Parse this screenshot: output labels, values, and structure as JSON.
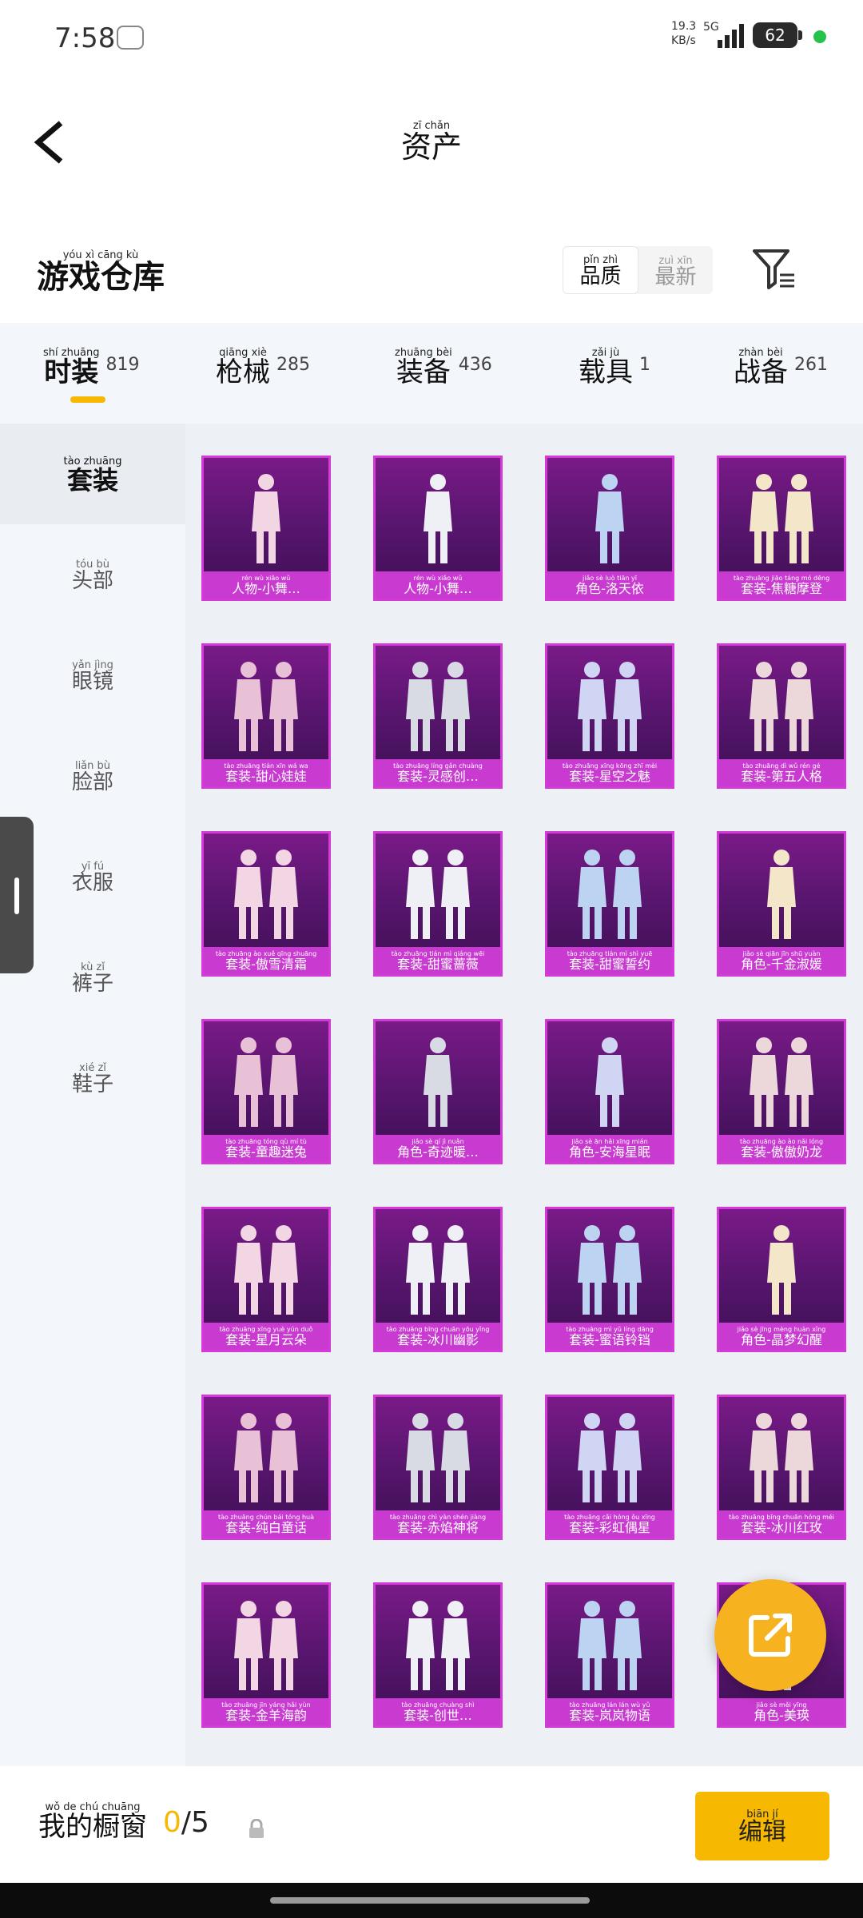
{
  "status_bar": {
    "time": "7:58",
    "net_speed_top": "19.3",
    "net_speed_unit": "KB/s",
    "network_type": "5G",
    "battery": "62"
  },
  "header": {
    "title": {
      "hz": "资产",
      "py": "zī chǎn"
    }
  },
  "warehouse": {
    "title": {
      "hz": "游戏仓库",
      "py": "yóu xì cāng kù"
    }
  },
  "sort_options": [
    {
      "hz": "品质",
      "py": "pǐn zhì",
      "active": true
    },
    {
      "hz": "最新",
      "py": "zuì xīn",
      "active": false
    }
  ],
  "tabs": [
    {
      "hz": "时装",
      "py": "shí zhuāng",
      "count": "819",
      "active": true
    },
    {
      "hz": "枪械",
      "py": "qiāng xiè",
      "count": "285"
    },
    {
      "hz": "装备",
      "py": "zhuāng bèi",
      "count": "436"
    },
    {
      "hz": "载具",
      "py": "zǎi jù",
      "count": "1"
    },
    {
      "hz": "战备",
      "py": "zhàn bèi",
      "count": "261"
    }
  ],
  "sidebar": [
    {
      "hz": "套装",
      "py": "tào zhuāng",
      "active": true
    },
    {
      "hz": "头部",
      "py": "tóu bù"
    },
    {
      "hz": "眼镜",
      "py": "yǎn jìng"
    },
    {
      "hz": "脸部",
      "py": "liǎn bù"
    },
    {
      "hz": "衣服",
      "py": "yī fú"
    },
    {
      "hz": "裤子",
      "py": "kù zǐ"
    },
    {
      "hz": "鞋子",
      "py": "xié zǐ"
    }
  ],
  "items": [
    {
      "name": "人物-小舞…",
      "py": "rén wù xiǎo wǔ"
    },
    {
      "name": "人物-小舞…",
      "py": "rén wù xiǎo wǔ"
    },
    {
      "name": "角色-洛天依",
      "py": "jiǎo sè luò tiān yī"
    },
    {
      "name": "套装-焦糖摩登",
      "py": "tào zhuāng jiāo táng mó dēng"
    },
    {
      "name": "套装-甜心娃娃",
      "py": "tào zhuāng tián xīn wá wa"
    },
    {
      "name": "套装-灵感创…",
      "py": "tào zhuāng líng gǎn chuàng"
    },
    {
      "name": "套装-星空之魅",
      "py": "tào zhuāng xīng kōng zhī mèi"
    },
    {
      "name": "套装-第五人格",
      "py": "tào zhuāng dì wǔ rén gé"
    },
    {
      "name": "套装-傲雪清霜",
      "py": "tào zhuāng ào xuě qīng shuāng"
    },
    {
      "name": "套装-甜蜜蔷薇",
      "py": "tào zhuāng tián mì qiáng wēi"
    },
    {
      "name": "套装-甜蜜誓约",
      "py": "tào zhuāng tián mì shì yuē"
    },
    {
      "name": "角色-千金淑媛",
      "py": "jiǎo sè qiān jīn shū yuàn"
    },
    {
      "name": "套装-童趣迷兔",
      "py": "tào zhuāng tóng qù mí tù"
    },
    {
      "name": "角色-奇迹暖…",
      "py": "jiǎo sè qí jì nuǎn"
    },
    {
      "name": "角色-安海星眠",
      "py": "jiǎo sè ān hǎi xīng mián"
    },
    {
      "name": "套装-傲傲奶龙",
      "py": "tào zhuāng ào ào nǎi lóng"
    },
    {
      "name": "套装-星月云朵",
      "py": "tào zhuāng xīng yuè yún duǒ"
    },
    {
      "name": "套装-冰川幽影",
      "py": "tào zhuāng bīng chuān yōu yǐng"
    },
    {
      "name": "套装-蜜语铃铛",
      "py": "tào zhuāng mì yǔ líng dāng"
    },
    {
      "name": "角色-晶梦幻醒",
      "py": "jiǎo sè jīng mèng huàn xǐng"
    },
    {
      "name": "套装-纯白童话",
      "py": "tào zhuāng chún bái tóng huà"
    },
    {
      "name": "套装-赤焰神将",
      "py": "tào zhuāng chì yàn shén jiàng"
    },
    {
      "name": "套装-彩虹偶星",
      "py": "tào zhuāng cǎi hóng ǒu xīng"
    },
    {
      "name": "套装-冰川红玫",
      "py": "tào zhuāng bīng chuān hóng méi"
    },
    {
      "name": "套装-金羊海韵",
      "py": "tào zhuāng jīn yáng hǎi yùn"
    },
    {
      "name": "套装-创世…",
      "py": "tào zhuāng chuàng shì"
    },
    {
      "name": "套装-岚岚物语",
      "py": "tào zhuāng lán lán wù yǔ"
    },
    {
      "name": "角色-美瑛",
      "py": "jiǎo sè měi yīng"
    }
  ],
  "bottom": {
    "showcase": {
      "hz": "我的橱窗",
      "py": "wǒ de chú chuāng"
    },
    "count_current": "0",
    "count_total": "/5",
    "edit": {
      "hz": "编辑",
      "py": "biān jí"
    }
  },
  "colors": {
    "accent": "#f6b800",
    "card_bg": "#6a1a80",
    "card_border": "#d43ad8",
    "fab": "#f7b21f"
  }
}
